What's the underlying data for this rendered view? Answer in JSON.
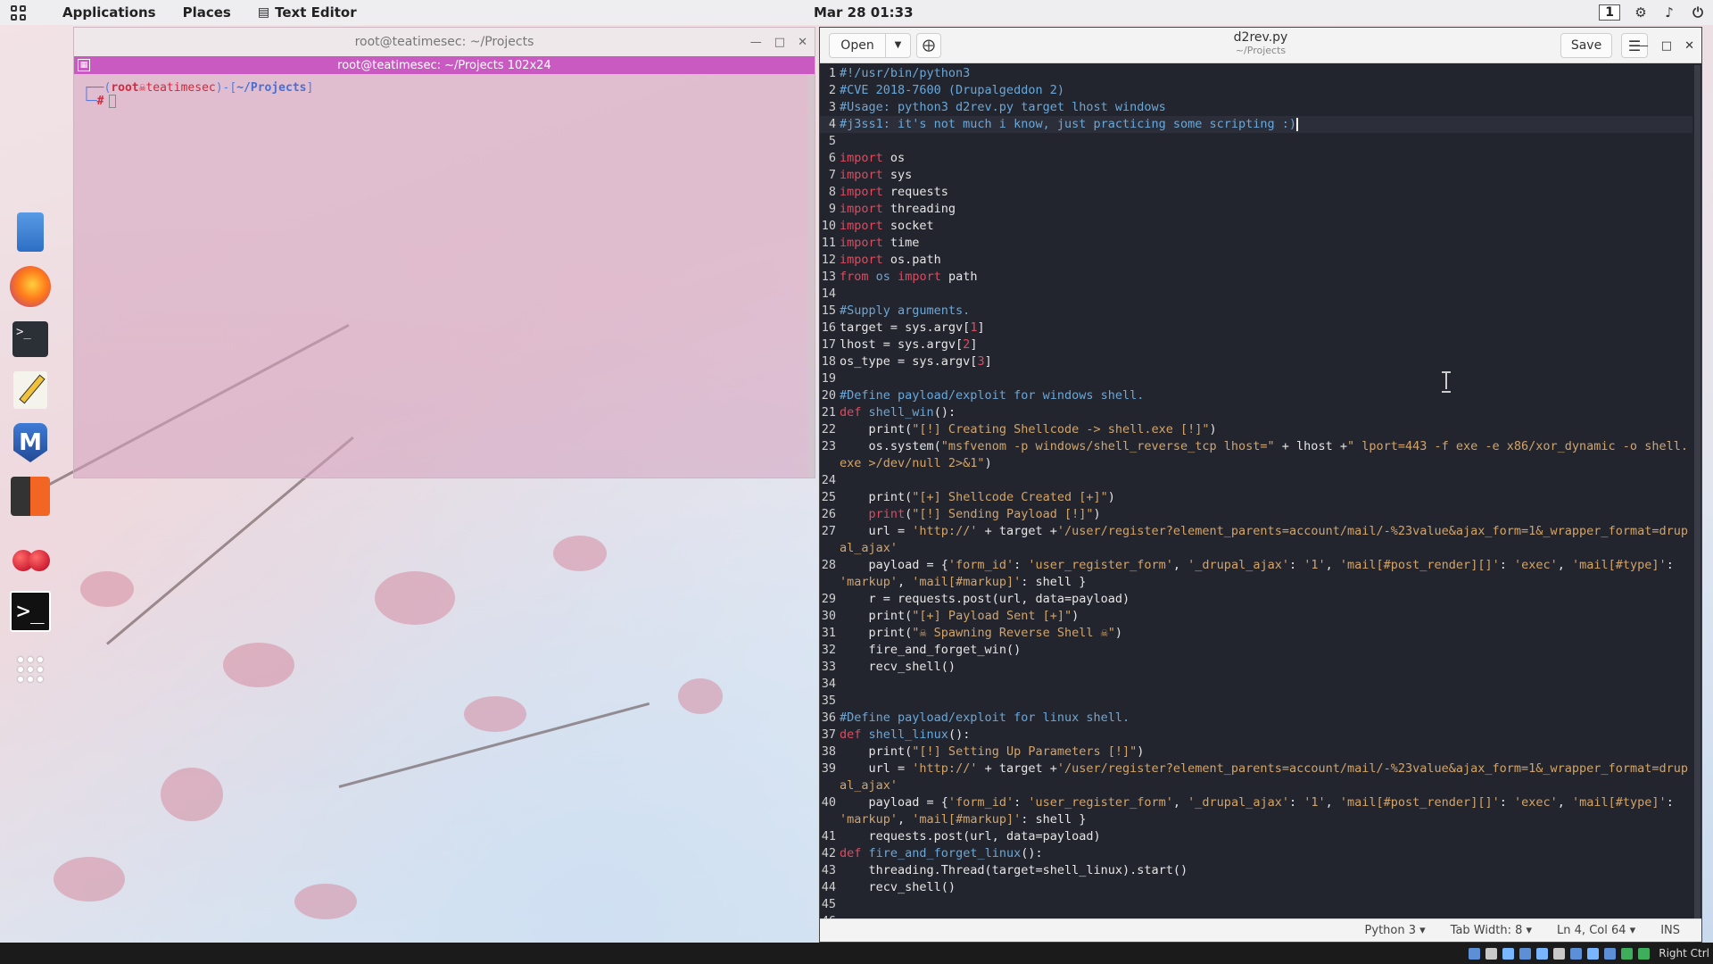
{
  "topbar": {
    "menus": [
      "Applications",
      "Places",
      "Text Editor"
    ],
    "clock": "Mar 28  01:33",
    "workspace": "1"
  },
  "dock": {
    "apps": [
      "files-icon",
      "firefox-icon",
      "terminal-icon",
      "text-editor-icon",
      "metasploit-icon",
      "burpsuite-icon",
      "cherrytree-icon",
      "terminal-emulator-icon",
      "app-grid-icon"
    ]
  },
  "terminal": {
    "title": "root@teatimesec: ~/Projects",
    "tab_title": "root@teatimesec: ~/Projects 102x24",
    "prompt_user": "root",
    "prompt_host": "teatimesec",
    "prompt_path": "~/Projects",
    "prompt_symbol": "#"
  },
  "editor": {
    "open_label": "Open",
    "save_label": "Save",
    "filename": "d2rev.py",
    "filepath": "~/Projects",
    "status": {
      "language": "Python 3",
      "tab_width": "Tab Width: 8",
      "position": "Ln 4, Col 64",
      "mode": "INS"
    },
    "active_line": 4
  },
  "tray": {
    "host_key": "Right Ctrl"
  },
  "colors": {
    "editor_bg": "#23252e",
    "comment": "#6aa7d8",
    "keyword": "#e04a5f",
    "string": "#d2a46a",
    "terminal_tab": "#c85ac1"
  }
}
